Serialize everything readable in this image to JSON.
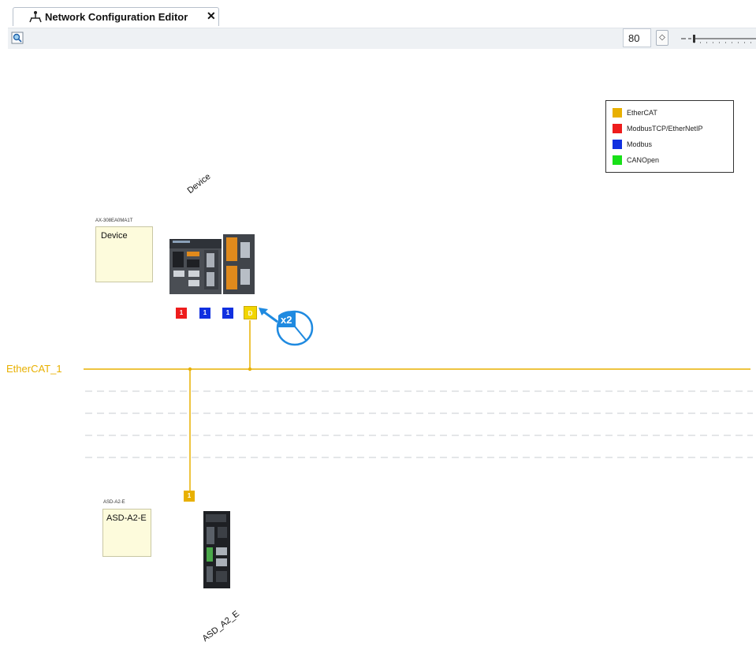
{
  "tab": {
    "title": "Network Configuration Editor",
    "close_label": "✕"
  },
  "toolbar": {
    "zoom_value": "80",
    "zoom_spinner": "◇"
  },
  "legend": [
    {
      "label": "EtherCAT",
      "color": "#e8b000"
    },
    {
      "label": "ModbusTCP/EtherNetIP",
      "color": "#ee1c1c"
    },
    {
      "label": "Modbus",
      "color": "#1030e0"
    },
    {
      "label": "CANOpen",
      "color": "#18e018"
    }
  ],
  "controller": {
    "model": "AX-308EA0MA1T",
    "box_label": "Device",
    "rotated_name": "Device",
    "ports": [
      {
        "label": "1",
        "color": "#ee1c1c"
      },
      {
        "label": "1",
        "color": "#1030e0"
      },
      {
        "label": "1",
        "color": "#1030e0"
      },
      {
        "label": "D",
        "color": "#f2d600"
      }
    ]
  },
  "callout": {
    "text": "x2"
  },
  "bus": {
    "label": "EtherCAT_1",
    "color": "#e8b000"
  },
  "drive": {
    "model": "ASD-A2-E",
    "box_label": "ASD-A2-E",
    "rotated_name": "ASD_A2_E",
    "port_label": "1"
  }
}
